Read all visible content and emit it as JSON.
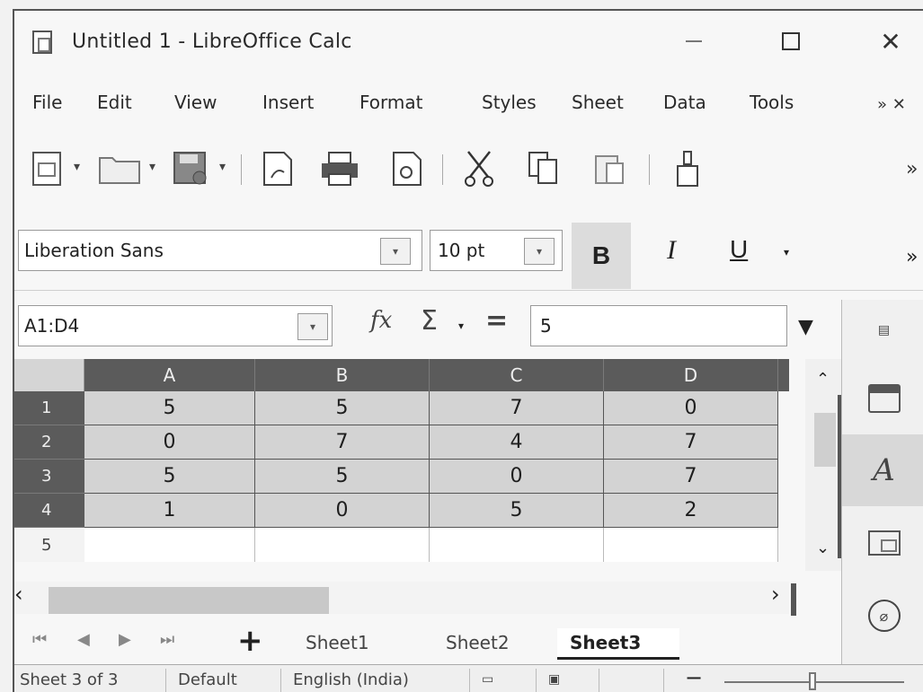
{
  "window": {
    "title": "Untitled 1 - LibreOffice Calc",
    "minimize": "—",
    "maximize": "",
    "close": "✕"
  },
  "menu": {
    "items": [
      "File",
      "Edit",
      "View",
      "Insert",
      "Format",
      "Styles",
      "Sheet",
      "Data",
      "Tools"
    ],
    "more": "» ✕"
  },
  "toolbar": {
    "more": "»"
  },
  "formatting": {
    "font_name": "Liberation Sans",
    "font_size": "10 pt",
    "bold": "B",
    "italic": "I",
    "underline": "U",
    "more": "»"
  },
  "formula_bar": {
    "name_box": "A1:D4",
    "fx": "fx",
    "sigma": "Σ",
    "equals": "=",
    "content": "5"
  },
  "grid": {
    "columns": [
      "A",
      "B",
      "C",
      "D"
    ],
    "row_numbers": [
      "1",
      "2",
      "3",
      "4",
      "5"
    ],
    "rows": [
      [
        "5",
        "5",
        "7",
        "0"
      ],
      [
        "0",
        "7",
        "4",
        "7"
      ],
      [
        "5",
        "5",
        "0",
        "7"
      ],
      [
        "1",
        "0",
        "5",
        "2"
      ]
    ]
  },
  "sheet_tabs": {
    "add": "+",
    "tabs": [
      "Sheet1",
      "Sheet2",
      "Sheet3"
    ],
    "active": "Sheet3"
  },
  "status_bar": {
    "sheet_pos": "Sheet 3 of 3",
    "page_style": "Default",
    "language": "English (India)"
  },
  "icons": {
    "app": "calc-app-icon",
    "new": "new-document-icon",
    "open": "open-folder-icon",
    "save": "save-icon",
    "export_pdf": "export-pdf-icon",
    "print": "print-icon",
    "preview": "print-preview-icon",
    "cut": "cut-icon",
    "copy": "copy-icon",
    "paste": "paste-icon",
    "clone": "clone-formatting-icon"
  }
}
